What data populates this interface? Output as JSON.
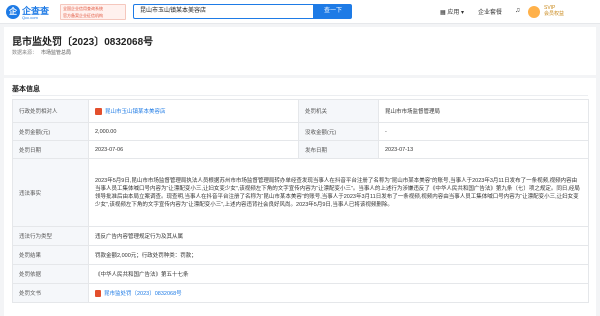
{
  "header": {
    "logo_text": "企查查",
    "logo_sub": "Qcc.com",
    "badge_lines": [
      "全国企业信用查询系统",
      "官方备案企业征信机构"
    ],
    "search_value": "昆山市玉山镇某本美容店",
    "search_button": "查一下",
    "nav": [
      "应用",
      "企业套餐"
    ],
    "vip": "SVIP",
    "vip_sub": "会员权益"
  },
  "title": {
    "text": "昆市监处罚〔2023〕0832068号",
    "source_label": "数据来源：",
    "source_value": "市场监管总局"
  },
  "section": {
    "title": "基本信息"
  },
  "rows": {
    "party_label": "行政处罚相对人",
    "party_value": "昆山市玉山镇某本美容店",
    "dept_label": "处罚机关",
    "dept_value": "昆山市市场监督管理局",
    "fine_label": "处罚金额(元)",
    "fine_value": "2,000.00",
    "confiscate_label": "没收金额(元)",
    "confiscate_value": "-",
    "date_label": "处罚日期",
    "date_value": "2023-07-06",
    "pub_label": "发布日期",
    "pub_value": "2023-07-13",
    "facts_label": "违法事实",
    "facts_value": "2023年5月9日,昆山市市场监督管理局执法人员根据苏州市市场监督管理局转办单经查发现当事人在抖音平台注册了名称为“昆山市某本美容”的账号,当事人于2023年3月11日发布了一条视频,视频内容由当事人员工集体喊口号内容为“让漂配变小三,让妇女变少女”,该视频左下角的文字宣传内容为“让漂配变小三”。当事人的上述行为涉嫌违反了《中华人民共和国广告法》第九条（七）项之规定。同日,经局领导批准后由本局立案调查。现查明,当事人在抖音平台注册了名称为“昆山市某本美容”的账号,当事人于2023年3月11日发布了一条视频,视频内容由当事人员工集体喊口号内容为“让漂配变小三,让妇女变少女”,该视频左下角的文字宣传内容为“让漂配变小三”,上述内容违背社会良好风尚。2023年5月9日,当事人已将该视频删除。",
    "type_label": "违法行为类型",
    "type_value": "违反广告内容管理规定行为及其从属",
    "result_label": "处罚结果",
    "result_value": "罚款金额2,000元；行政处罚种类：罚款；",
    "basis_label": "处罚依据",
    "basis_value": "《中华人民共和国广告法》第五十七条",
    "doc_label": "处罚文书",
    "doc_value": "昆市监处罚〔2023〕0832068号"
  }
}
